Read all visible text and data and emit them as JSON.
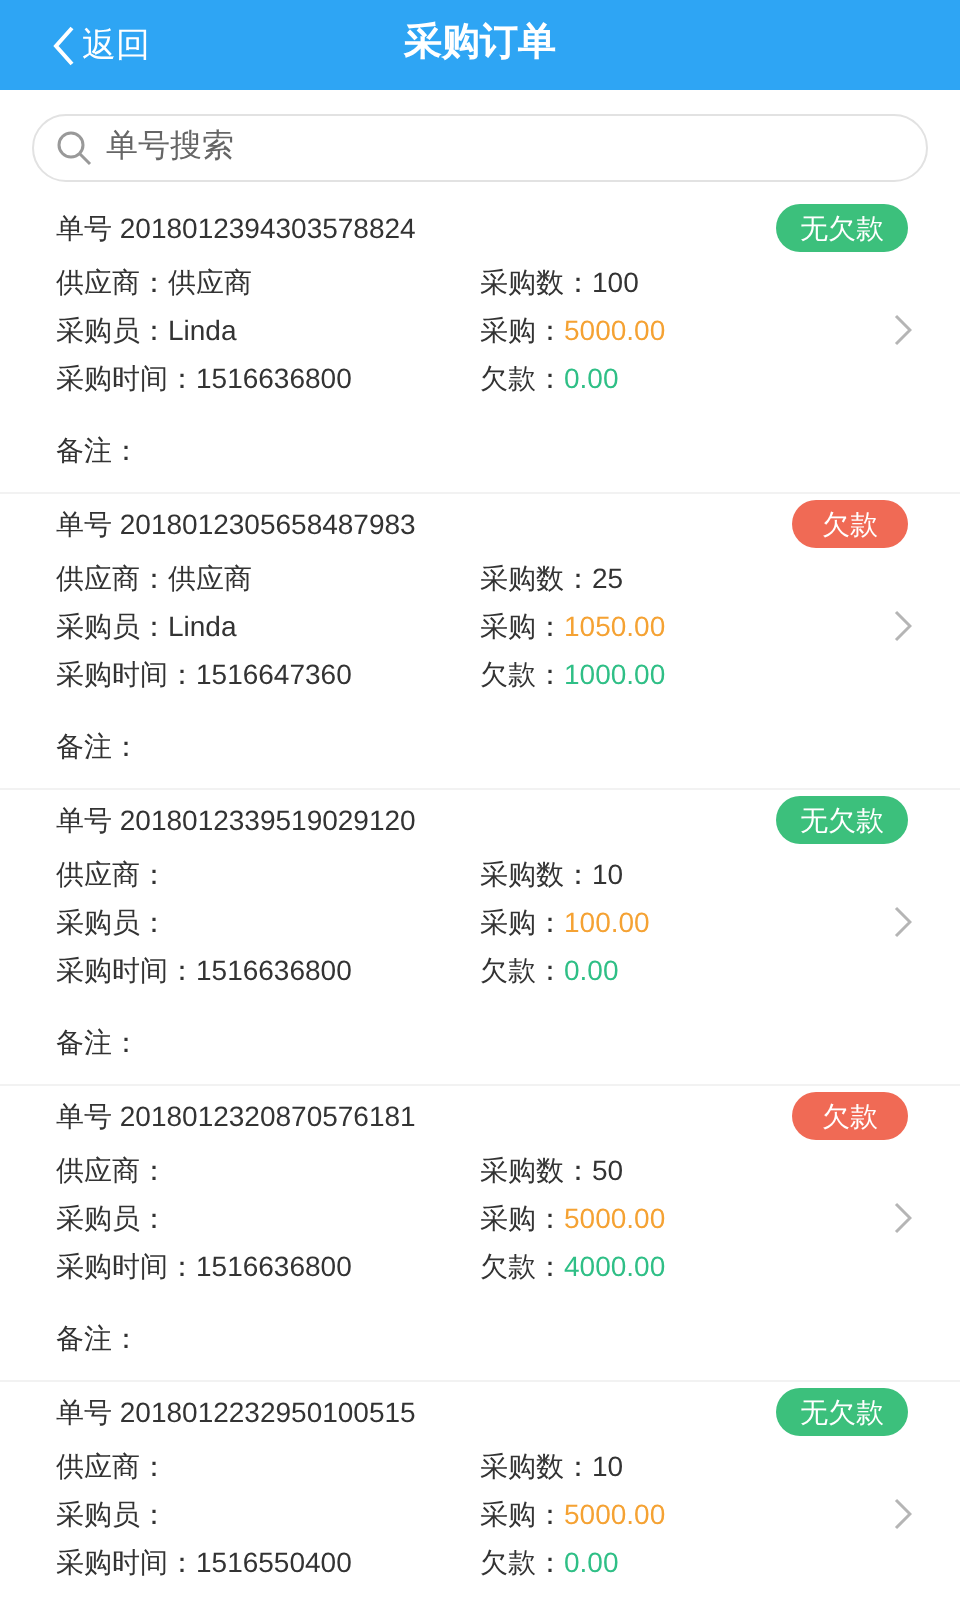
{
  "header": {
    "back_label": "返回",
    "title": "采购订单"
  },
  "search": {
    "placeholder": "单号搜索"
  },
  "orders": [
    {
      "no_label": "单号",
      "no": "2018012394303578824",
      "status": {
        "text": "无欠款",
        "kind": "paid"
      },
      "left": [
        {
          "label": "供应商：",
          "value": "供应商"
        },
        {
          "label": "采购员：",
          "value": "Linda"
        },
        {
          "label": "采购时间：",
          "value": "1516636800"
        }
      ],
      "right": [
        {
          "label": "采购数：",
          "value": "100",
          "kind": "plain"
        },
        {
          "label": "采购：",
          "value": "5000.00",
          "kind": "amount"
        },
        {
          "label": "欠款：",
          "value": "0.00",
          "kind": "debt"
        }
      ],
      "remark_label": "备注："
    },
    {
      "no_label": "单号",
      "no": "2018012305658487983",
      "status": {
        "text": "欠款",
        "kind": "owing"
      },
      "left": [
        {
          "label": "供应商：",
          "value": "供应商"
        },
        {
          "label": "采购员：",
          "value": "Linda"
        },
        {
          "label": "采购时间：",
          "value": "1516647360"
        }
      ],
      "right": [
        {
          "label": "采购数：",
          "value": "25",
          "kind": "plain"
        },
        {
          "label": "采购：",
          "value": "1050.00",
          "kind": "amount"
        },
        {
          "label": "欠款：",
          "value": "1000.00",
          "kind": "debt"
        }
      ],
      "remark_label": "备注："
    },
    {
      "no_label": "单号",
      "no": "2018012339519029120",
      "status": {
        "text": "无欠款",
        "kind": "paid"
      },
      "left": [
        {
          "label": "供应商："
        },
        {
          "label": "采购员："
        },
        {
          "label": "采购时间：",
          "value": "1516636800"
        }
      ],
      "right": [
        {
          "label": "采购数：",
          "value": "10",
          "kind": "plain"
        },
        {
          "label": "采购：",
          "value": "100.00",
          "kind": "amount"
        },
        {
          "label": "欠款：",
          "value": "0.00",
          "kind": "debt"
        }
      ],
      "remark_label": "备注："
    },
    {
      "no_label": "单号",
      "no": "2018012320870576181",
      "status": {
        "text": "欠款",
        "kind": "owing"
      },
      "left": [
        {
          "label": "供应商："
        },
        {
          "label": "采购员："
        },
        {
          "label": "采购时间：",
          "value": "1516636800"
        }
      ],
      "right": [
        {
          "label": "采购数：",
          "value": "50",
          "kind": "plain"
        },
        {
          "label": "采购：",
          "value": "5000.00",
          "kind": "amount"
        },
        {
          "label": "欠款：",
          "value": "4000.00",
          "kind": "debt"
        }
      ],
      "remark_label": "备注："
    },
    {
      "no_label": "单号",
      "no": "2018012232950100515",
      "status": {
        "text": "无欠款",
        "kind": "paid"
      },
      "left": [
        {
          "label": "供应商："
        },
        {
          "label": "采购员："
        },
        {
          "label": "采购时间：",
          "value": "1516550400"
        }
      ],
      "right": [
        {
          "label": "采购数：",
          "value": "10",
          "kind": "plain"
        },
        {
          "label": "采购：",
          "value": "5000.00",
          "kind": "amount"
        },
        {
          "label": "欠款：",
          "value": "0.00",
          "kind": "debt"
        }
      ]
    }
  ]
}
